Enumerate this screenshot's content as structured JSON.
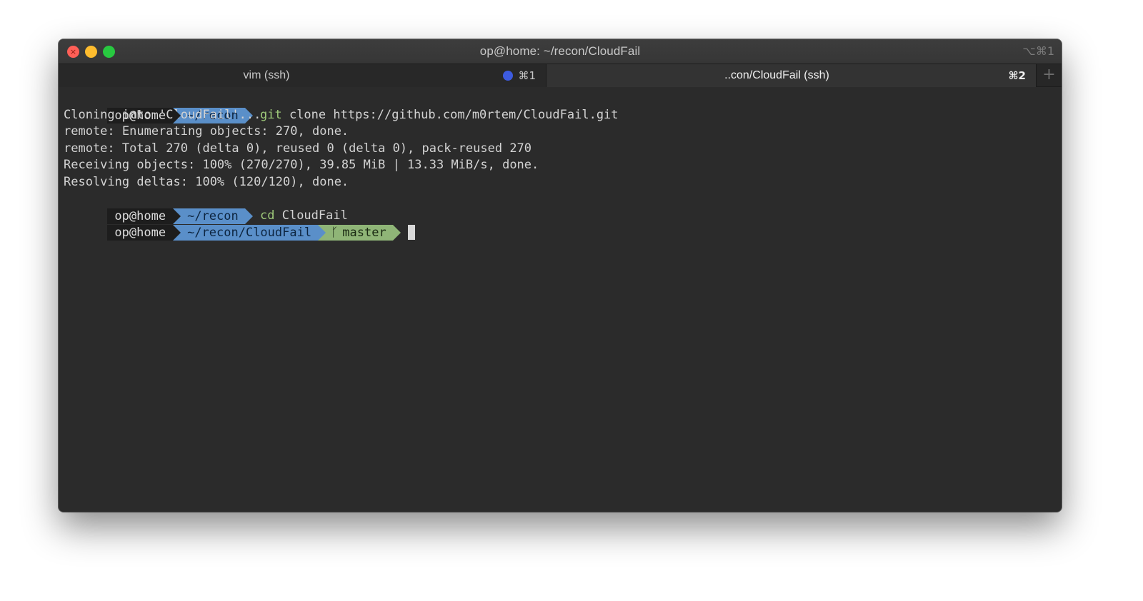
{
  "window": {
    "title": "op@home: ~/recon/CloudFail",
    "title_shortcut": "⌥⌘1",
    "traffic_lights": [
      "close",
      "minimize",
      "zoom"
    ]
  },
  "tabs": [
    {
      "label": "vim (ssh)",
      "shortcut": "⌘1",
      "activity_indicator": true,
      "active": false
    },
    {
      "label": "..con/CloudFail (ssh)",
      "shortcut": "⌘2",
      "activity_indicator": false,
      "active": true
    }
  ],
  "new_tab_label": "+",
  "colors": {
    "terminal_bg": "#2b2b2b",
    "prompt_user_bg": "#1d1d1d",
    "prompt_dir_bg": "#5a8fc9",
    "prompt_git_bg": "#8fb577",
    "command_color": "#9fca7a",
    "activity_dot": "#3d5be0"
  },
  "terminal": {
    "cmd1": {
      "user": "op@home",
      "dir": "~/recon",
      "command": "git",
      "args": "clone https://github.com/m0rtem/CloudFail.git"
    },
    "output": [
      "Cloning into 'CloudFail'...",
      "remote: Enumerating objects: 270, done.",
      "remote: Total 270 (delta 0), reused 0 (delta 0), pack-reused 270",
      "Receiving objects: 100% (270/270), 39.85 MiB | 13.33 MiB/s, done.",
      "Resolving deltas: 100% (120/120), done."
    ],
    "cmd2": {
      "user": "op@home",
      "dir": "~/recon",
      "command": "cd",
      "args": "CloudFail"
    },
    "current": {
      "user": "op@home",
      "dir": "~/recon/CloudFail",
      "branch_icon": "git-branch-icon",
      "branch": "master"
    }
  }
}
